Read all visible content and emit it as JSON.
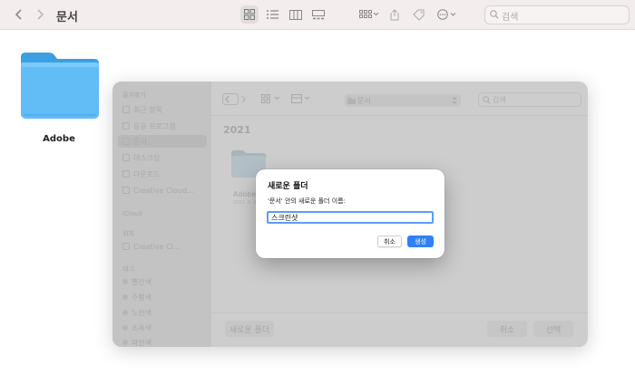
{
  "window": {
    "title": "문서",
    "search": {
      "placeholder": "검색"
    },
    "folders": [
      {
        "name": "Adobe"
      }
    ]
  },
  "sheet": {
    "sidebar": {
      "sections": [
        {
          "heading": "즐겨찾기",
          "items": [
            "최근 항목",
            "응용 프로그램",
            "문서",
            "데스크탑",
            "다운로드",
            "Creative Cloud..."
          ]
        },
        {
          "heading": "iCloud",
          "items": []
        },
        {
          "heading": "위치",
          "items": [
            "Creative Cl..."
          ]
        },
        {
          "heading": "태그",
          "items": [
            "빨간색",
            "주황색",
            "노란색",
            "초록색",
            "파란색",
            "보라색"
          ]
        }
      ]
    },
    "path": "문서",
    "search": {
      "placeholder": "검색"
    },
    "group_header": "2021",
    "folder": {
      "name": "Adobe",
      "subtitle": "2021. 9. 3."
    },
    "buttons": {
      "new_folder": "새로운 폴더",
      "cancel": "취소",
      "select": "선택"
    }
  },
  "dialog": {
    "title": "새로운 폴더",
    "prompt": "'문서' 안의 새로운 폴더 이름:",
    "input_value": "스크린샷",
    "buttons": {
      "cancel": "취소",
      "create": "생성"
    }
  },
  "colors": {
    "accent": "#2f80f6",
    "folder_blue": "#5bb8f5",
    "focus_ring": "#5c9df5"
  }
}
